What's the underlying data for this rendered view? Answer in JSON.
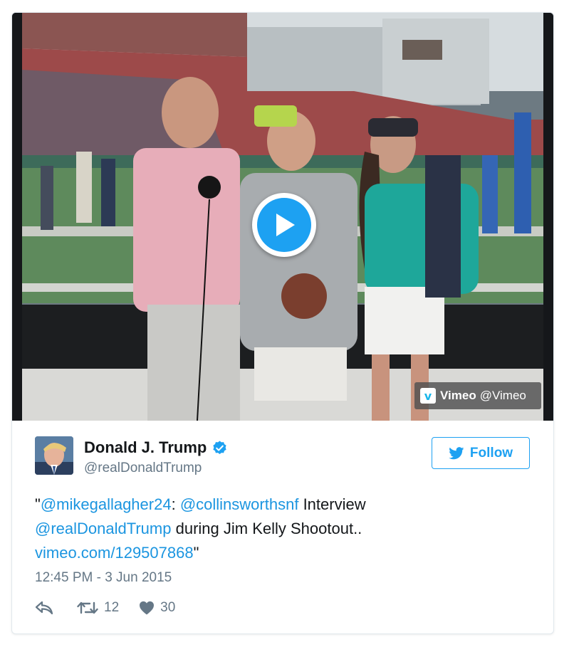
{
  "video": {
    "provider_name": "Vimeo",
    "provider_handle": "@Vimeo",
    "play_icon": "play-icon"
  },
  "author": {
    "display_name": "Donald J. Trump",
    "handle": "@realDonaldTrump",
    "verified_icon": "verified-badge-icon"
  },
  "follow": {
    "label": "Follow",
    "icon": "twitter-bird-icon"
  },
  "tweet": {
    "segments": {
      "s1": "\"",
      "m1": "@mikegallagher24",
      "s2": ": ",
      "m2": "@collinsworthsnf",
      "s3": " Interview",
      "m3": "@realDonaldTrump",
      "s4": " during Jim Kelly Shootout..",
      "link": "vimeo.com/129507868",
      "s5": "\""
    },
    "timestamp": "12:45 PM - 3 Jun 2015"
  },
  "actions": {
    "retweet_count": "12",
    "like_count": "30"
  },
  "colors": {
    "link": "#1b95e0",
    "accent": "#1da1f2",
    "muted": "#657786",
    "border": "#e1e8ed"
  }
}
